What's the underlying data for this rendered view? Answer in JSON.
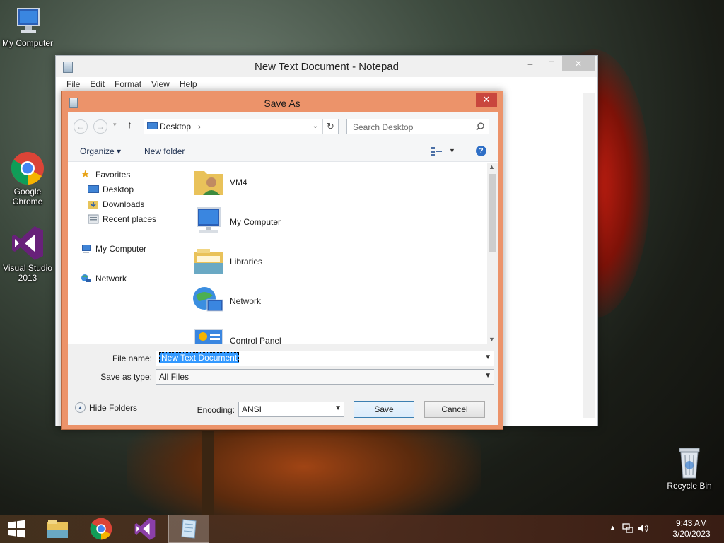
{
  "desktop": {
    "icons": [
      {
        "label": "My Computer"
      },
      {
        "label": "Google Chrome"
      },
      {
        "label": "Visual Studio 2013"
      },
      {
        "label": "Recycle Bin"
      }
    ]
  },
  "notepad": {
    "title": "New Text Document - Notepad",
    "menu": [
      "File",
      "Edit",
      "Format",
      "View",
      "Help"
    ],
    "controls": {
      "minimize": "–",
      "maximize": "□",
      "close": "✕"
    }
  },
  "save_dialog": {
    "title": "Save As",
    "close": "✕",
    "address": {
      "location": "Desktop",
      "separator": "›"
    },
    "search": {
      "placeholder": "Search Desktop"
    },
    "commands": {
      "organize": "Organize ▾",
      "new_folder": "New folder"
    },
    "nav": {
      "favorites": "Favorites",
      "desktop": "Desktop",
      "downloads": "Downloads",
      "recent_places": "Recent places",
      "my_computer": "My Computer",
      "network": "Network"
    },
    "files": [
      {
        "name": "VM4",
        "icon": "user-folder-icon"
      },
      {
        "name": "My Computer",
        "icon": "computer-icon"
      },
      {
        "name": "Libraries",
        "icon": "libraries-icon"
      },
      {
        "name": "Network",
        "icon": "network-icon"
      },
      {
        "name": "Control Panel",
        "icon": "control-panel-icon"
      }
    ],
    "file_name": {
      "label": "File name:",
      "value": "New Text Document"
    },
    "save_as_type": {
      "label": "Save as type:",
      "value": "All Files"
    },
    "hide_folders": "Hide Folders",
    "encoding": {
      "label": "Encoding:",
      "value": "ANSI"
    },
    "buttons": {
      "save": "Save",
      "cancel": "Cancel"
    }
  },
  "taskbar": {
    "clock": {
      "time": "9:43 AM",
      "date": "3/20/2023"
    }
  },
  "colors": {
    "dialog_frame": "#ec936a",
    "selection": "#3399ff"
  }
}
